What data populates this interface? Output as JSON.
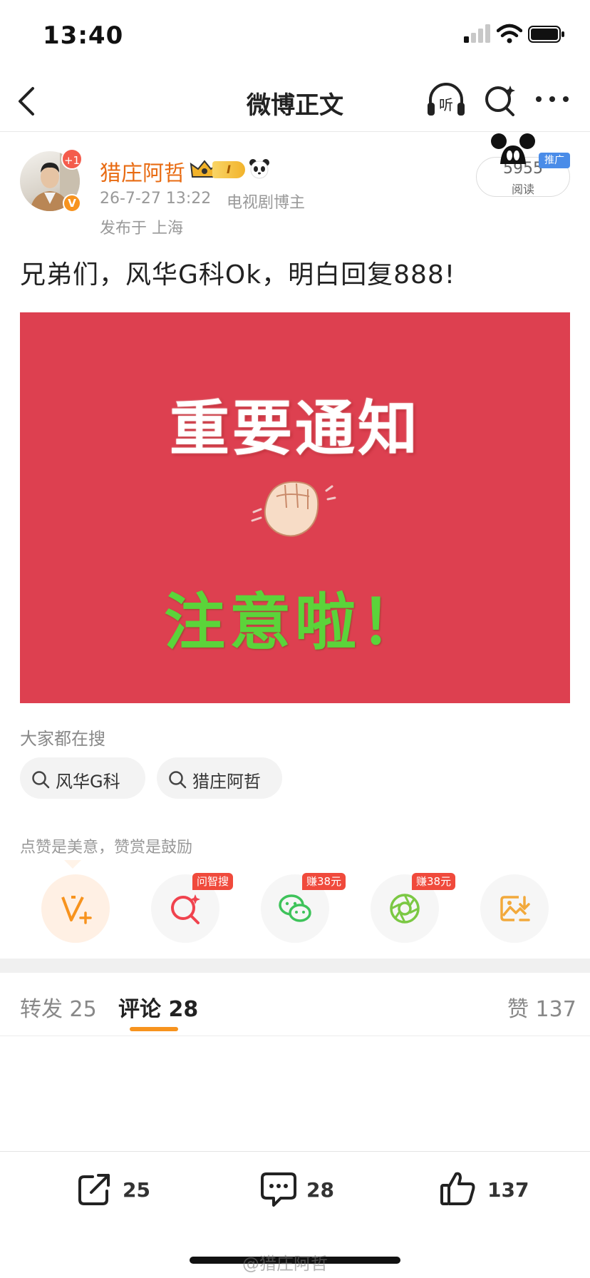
{
  "status_bar": {
    "time": "13:40"
  },
  "nav": {
    "title": "微博正文"
  },
  "author": {
    "name": "猎庄阿哲",
    "avatar_badge": "+1",
    "verified_badge": "V",
    "vip_level": "I",
    "post_time": "26-7-27 13:22",
    "role": "电视剧博主",
    "location": "发布于 上海"
  },
  "reads": {
    "count": "5955",
    "label": "阅读",
    "promo": "推广"
  },
  "post": {
    "text": "兄弟们，风华G科Ok，明白回复888!",
    "image": {
      "title": "重要通知",
      "subtitle": "注意啦！"
    }
  },
  "trending": {
    "title": "大家都在搜",
    "items": [
      {
        "label": "风华G科"
      },
      {
        "label": "猎庄阿哲"
      }
    ]
  },
  "reward": {
    "title": "点赞是美意，赞赏是鼓励",
    "badges": {
      "search": "问智搜",
      "wechat": "赚38元",
      "moments": "赚38元"
    }
  },
  "tabs": {
    "repost": "转发 25",
    "comment": "评论 28",
    "like": "赞 137"
  },
  "bottom_bar": {
    "repost_count": "25",
    "comment_count": "28",
    "like_count": "137"
  },
  "watermark": "@猎庄阿哲",
  "colors": {
    "accent": "#f7931e",
    "name": "#e86b12",
    "image_bg": "#dd4050"
  }
}
